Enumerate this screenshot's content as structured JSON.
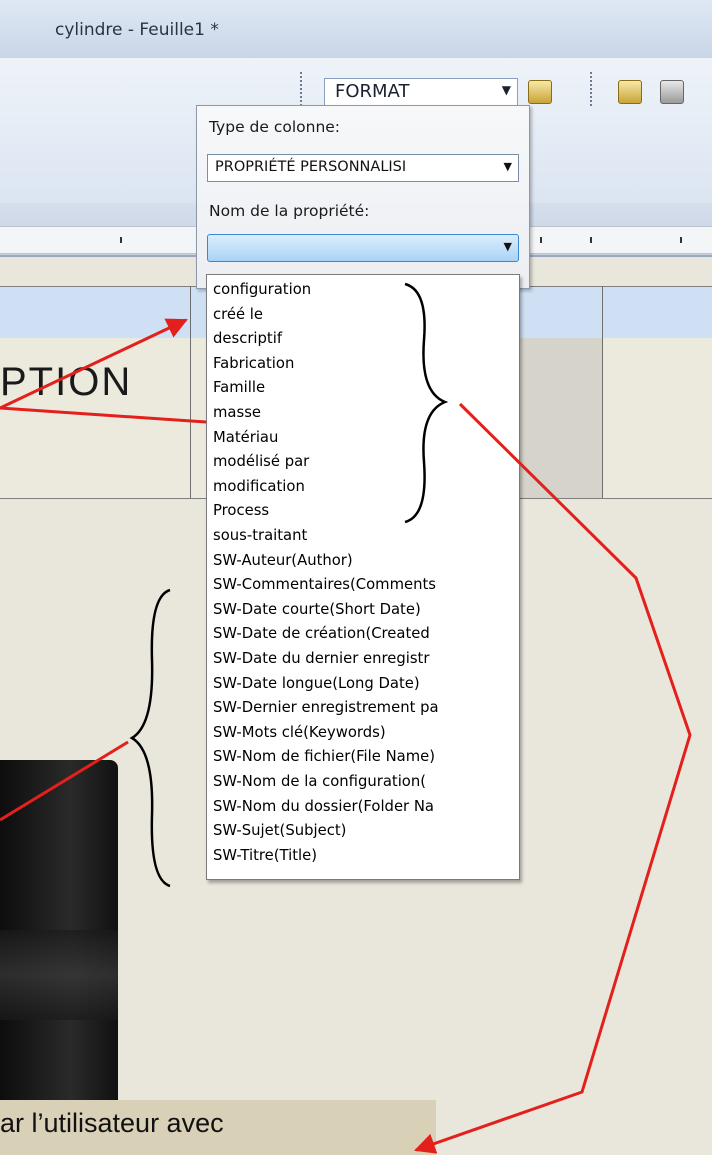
{
  "window": {
    "title": "cylindre - Feuille1 *"
  },
  "toolbar": {
    "format_value": "FORMAT"
  },
  "table": {
    "visible_header_fragment": "PTION"
  },
  "panel": {
    "column_type_label": "Type de colonne:",
    "column_type_value": "PROPRIÉTÉ PERSONNALISI",
    "property_name_label": "Nom de la propriété:",
    "property_name_value": ""
  },
  "property_list": [
    "configuration",
    "créé le",
    "descriptif",
    "Fabrication",
    "Famille",
    "masse",
    "Matériau",
    "modélisé par",
    "modification",
    "Process",
    "sous-traitant",
    "SW-Auteur(Author)",
    "SW-Commentaires(Comments",
    "SW-Date courte(Short Date)",
    "SW-Date de création(Created",
    "SW-Date du dernier enregistr",
    "SW-Date longue(Long Date)",
    "SW-Dernier enregistrement pa",
    "SW-Mots clé(Keywords)",
    "SW-Nom de fichier(File Name)",
    "SW-Nom de la configuration(",
    "SW-Nom du dossier(Folder Na",
    "SW-Sujet(Subject)",
    "SW-Titre(Title)"
  ],
  "caption": {
    "text": "ar l’utilisateur avec"
  },
  "colors": {
    "annotation_red": "#e3201b",
    "list_bg": "#ffffff",
    "header_row": "#cfe0f5"
  },
  "icons": [
    "dropdown-arrow-icon",
    "tb-box-icon",
    "tb-paint-icon"
  ]
}
